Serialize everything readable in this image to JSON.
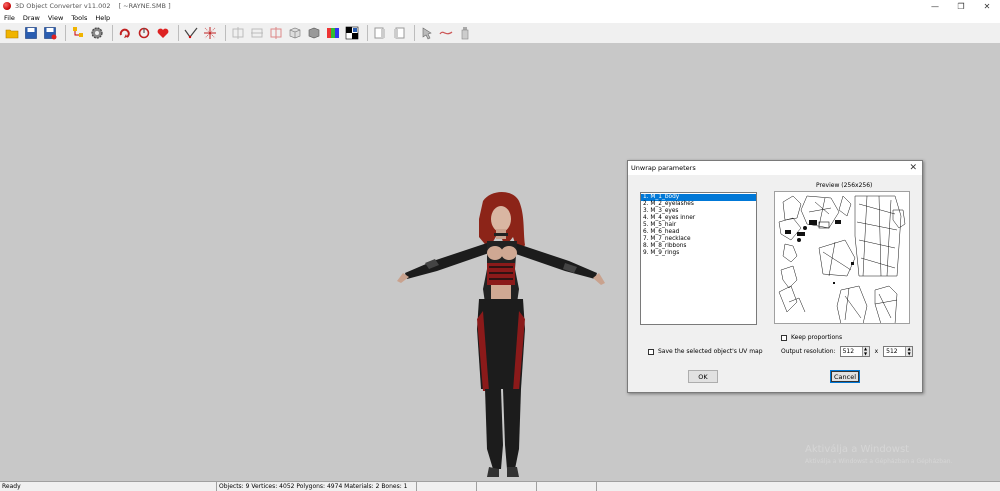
{
  "window": {
    "title": "3D Object Converter v11.002",
    "document": "[ ~RAYNE.SMB ]",
    "controls": [
      "minimize-icon",
      "restore-icon",
      "close-icon"
    ]
  },
  "menu": [
    "File",
    "Draw",
    "View",
    "Tools",
    "Help"
  ],
  "toolbar": {
    "buttons": [
      "open-folder-icon",
      "save-icon",
      "save-as-icon",
      "hierarchy-icon",
      "settings-gear-icon",
      "rotate-icon",
      "rotate-alt-icon",
      "heart-red-icon",
      "vertex-line-icon",
      "move-arrows-icon",
      "mirror-x-icon",
      "mirror-y-icon",
      "mirror-z-icon",
      "cube-icon",
      "wireframe-cube-icon",
      "rgb-color-icon",
      "checker-icon",
      "texture-left-icon",
      "texture-right-icon",
      "pointer-icon",
      "curve-icon",
      "bottle-icon"
    ]
  },
  "watermark": {
    "title": "Aktiválja a Windowst",
    "subtitle": "Aktiválja a Windowst a Gépházban a Gépházban."
  },
  "status": {
    "ready": "Ready",
    "stats": "Objects: 9   Vertices: 4052   Polygons: 4974   Materials: 2   Bones: 1"
  },
  "dialog": {
    "title": "Unwrap parameters",
    "preview_label": "Preview (256x256)",
    "objects": [
      "1.  M_1_body",
      "2.  M_2_eyelashes",
      "3.  M_3_eyes",
      "4.  M_4_eyes inner",
      "5.  M_5_hair",
      "6.  M_6_head",
      "7.  M_7_necklace",
      "8.  M_8_ribbons",
      "9.  M_9_rings"
    ],
    "selected_index": 0,
    "save_uv_label": "Save the selected object's UV map",
    "keep_proportions_label": "Keep proportions",
    "output_resolution_label": "Output resolution:",
    "res_width": "512",
    "res_separator": "x",
    "res_height": "512",
    "ok_label": "OK",
    "cancel_label": "Cancel"
  },
  "colors": {
    "viewport_bg": "#c8c8c8",
    "selection": "#0078d7",
    "model_red": "#8b1a1a"
  }
}
